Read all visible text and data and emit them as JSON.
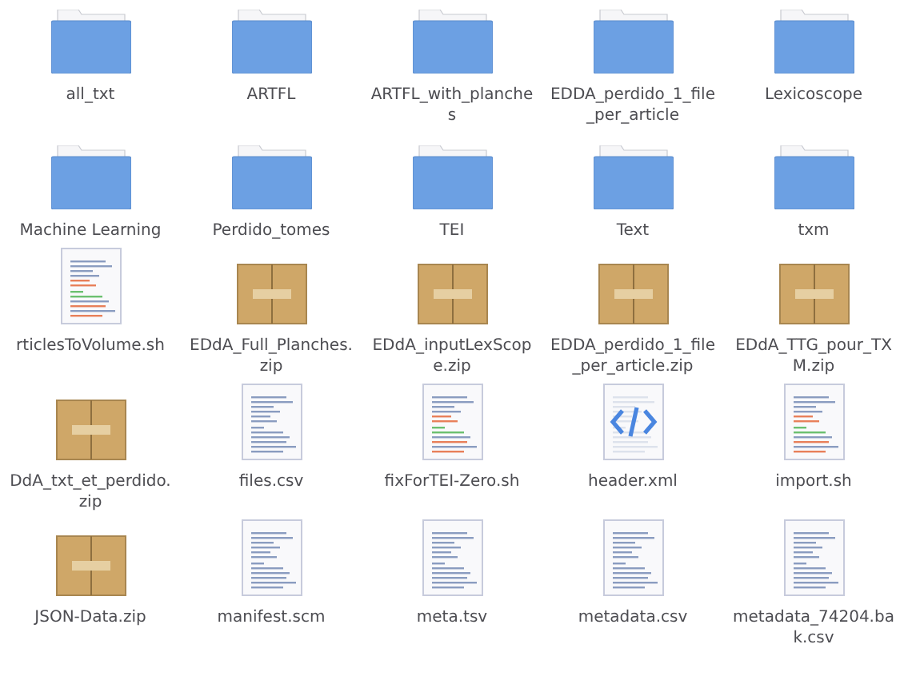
{
  "files": [
    {
      "name": "all_txt",
      "kind": "folder"
    },
    {
      "name": "ARTFL",
      "kind": "folder"
    },
    {
      "name": "ARTFL_with_planches",
      "kind": "folder"
    },
    {
      "name": "EDDA_perdido_1_file_per_article",
      "kind": "folder"
    },
    {
      "name": "Lexicoscope",
      "kind": "folder"
    },
    {
      "name": "Machine Learning",
      "kind": "folder"
    },
    {
      "name": "Perdido_tomes",
      "kind": "folder"
    },
    {
      "name": "TEI",
      "kind": "folder"
    },
    {
      "name": "Text",
      "kind": "folder"
    },
    {
      "name": "txm",
      "kind": "folder"
    },
    {
      "name": "rticlesToVolume.sh",
      "kind": "script"
    },
    {
      "name": "EDdA_Full_Planches.zip",
      "kind": "archive"
    },
    {
      "name": "EDdA_inputLexScope.zip",
      "kind": "archive"
    },
    {
      "name": "EDDA_perdido_1_file_per_article.zip",
      "kind": "archive"
    },
    {
      "name": "EDdA_TTG_pour_TXM.zip",
      "kind": "archive"
    },
    {
      "name": "DdA_txt_et_perdido.zip",
      "kind": "archive"
    },
    {
      "name": "files.csv",
      "kind": "text"
    },
    {
      "name": "fixForTEI-Zero.sh",
      "kind": "script"
    },
    {
      "name": "header.xml",
      "kind": "xml"
    },
    {
      "name": "import.sh",
      "kind": "script"
    },
    {
      "name": "JSON-Data.zip",
      "kind": "archive"
    },
    {
      "name": "manifest.scm",
      "kind": "text"
    },
    {
      "name": "meta.tsv",
      "kind": "text"
    },
    {
      "name": "metadata.csv",
      "kind": "text"
    },
    {
      "name": "metadata_74204.bak.csv",
      "kind": "text"
    }
  ]
}
